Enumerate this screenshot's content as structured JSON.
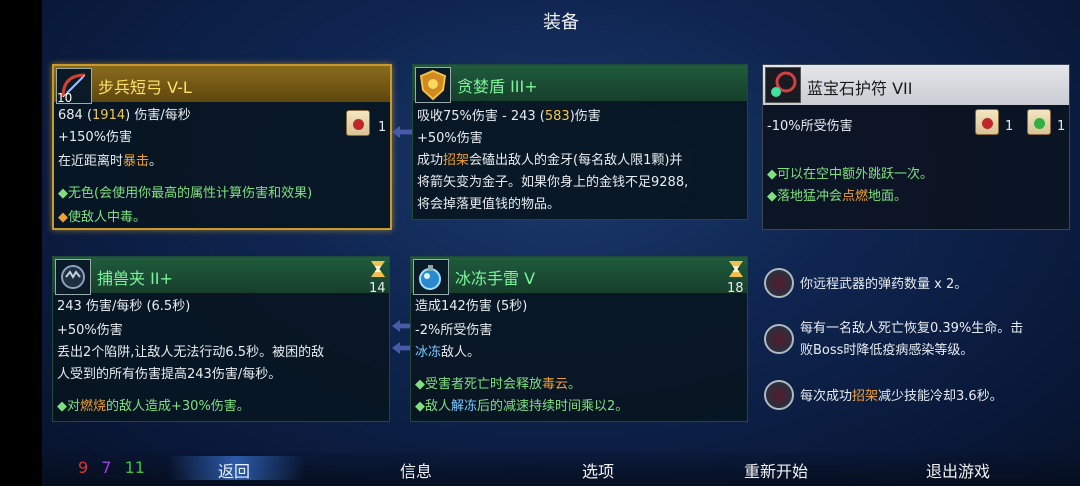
{
  "title": "装备",
  "cards": {
    "bow": {
      "name": "步兵短弓 V-L",
      "level_badge": "10",
      "line1_a": "684 (",
      "line1_b": "1914",
      "line1_c": ") 伤害/每秒",
      "line2": "+150%伤害",
      "line3_a": "在近距离时",
      "line3_b": "暴击",
      "line3_c": "。",
      "bullet1": "◆无色(会使用你最高的属性计算伤害和效果)",
      "bullet2": "使敌人中毒。",
      "scroll_count": "1"
    },
    "shield": {
      "name": "贪婪盾 III+",
      "line1_a": "吸收75%伤害 - 243 (",
      "line1_b": "583",
      "line1_c": ")伤害",
      "line2": "+50%伤害",
      "line3_a": "成功",
      "line3_b": "招架",
      "line3_c": "会磕出敌人的金牙(每名敌人限1颗)并",
      "line4": "将箭矢变为金子。如果你身上的金钱不足9288,",
      "line5": "将会掉落更值钱的物品。"
    },
    "amulet": {
      "name": "蓝宝石护符 VII",
      "line1": "-10%所受伤害",
      "scroll1_count": "1",
      "scroll2_count": "1",
      "bullet1": "◆可以在空中额外跳跃一次。",
      "bullet2_a": "◆落地猛冲会",
      "bullet2_b": "点燃",
      "bullet2_c": "地面。"
    },
    "trap": {
      "name": "捕兽夹 II+",
      "cooldown": "14",
      "line1": "243 伤害/每秒 (6.5秒)",
      "line2": "+50%伤害",
      "line3": "丢出2个陷阱,让敌人无法行动6.5秒。被困的敌",
      "line4": "人受到的所有伤害提高243伤害/每秒。",
      "bullet_a": "◆对",
      "bullet_b": "燃烧",
      "bullet_c": "的敌人造成+30%伤害。"
    },
    "grenade": {
      "name": "冰冻手雷 V",
      "cooldown": "18",
      "line1": "造成142伤害 (5秒)",
      "line2": "-2%所受伤害",
      "line3_a": "冰冻",
      "line3_b": "敌人。",
      "bullet1_a": "◆受害者死亡时会释放",
      "bullet1_b": "毒云",
      "bullet1_c": "。",
      "bullet2_a": "◆敌人",
      "bullet2_b": "解冻",
      "bullet2_c": "后的减速持续时间乘以2。"
    }
  },
  "perks": [
    {
      "icon": "ammo-perk-icon",
      "text": "你远程武器的弹药数量 x 2。"
    },
    {
      "icon": "vampire-perk-icon",
      "line1": "每有一名敌人死亡恢复0.39%生命。击",
      "line2": "败Boss时降低疫病感染等级。"
    },
    {
      "icon": "parry-perk-icon",
      "a": "每次成功",
      "b": "招架",
      "c": "减少技能冷却3.6秒。"
    }
  ],
  "stats": {
    "brutality": "9",
    "tactics": "7",
    "survival": "11"
  },
  "nav": {
    "back": "返回",
    "info": "信息",
    "options": "选项",
    "restart": "重新开始",
    "quit": "退出游戏"
  },
  "colors": {
    "brutality": "#e03030",
    "tactics": "#a040e0",
    "survival": "#40c040",
    "accent_gold": "#c99a2a"
  }
}
